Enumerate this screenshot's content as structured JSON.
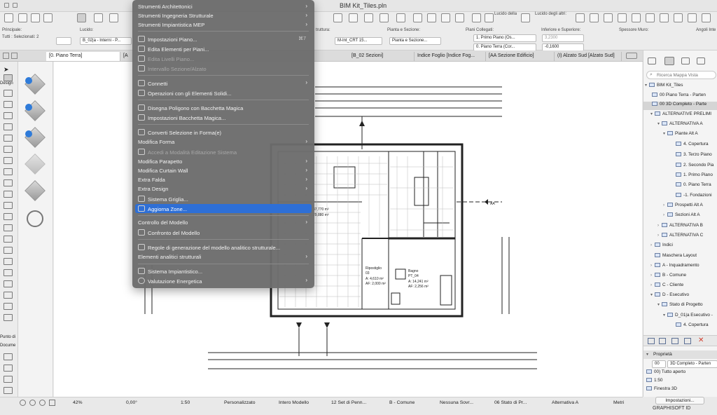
{
  "window": {
    "title": "BIM Kit_Tiles.pln"
  },
  "toolbar": {
    "principale": "Principale:",
    "selezionati": "Tutti : Selezionati: 2",
    "lucido_label": "Lucido:",
    "lucido_value": "B_02|a - Interni - P...",
    "struttura_label": "truttura:",
    "struttura_value": "M-Int_CRT 15...",
    "pianta_sezione_label": "Pianta e Sezione:",
    "pianta_sezione_value": "Pianta e Sezione...",
    "piani_collegati_label": "Piani Collegati:",
    "piano_1": "1. Primo Piano (Os...",
    "piano_0": "0. Piano Terra (Cor...",
    "inferiore_label": "Inferiore e Superiore:",
    "inferiore_1": "3,2300",
    "inferiore_2": "-0,1600",
    "spessore_label": "Spessore Muro:",
    "angoli_label": "Angoli Inte",
    "lucido_della": "Lucido della",
    "lucido_degli_altri": "Lucido degli altri:"
  },
  "tabs": [
    {
      "label": "[0. Piano Terra]"
    },
    {
      "label": "[A"
    },
    {
      "label": "[B_02 Sezioni]"
    },
    {
      "label": "Indice Foglio [Indice Fog..."
    },
    {
      "label": "[AA Sezione Edificio]"
    },
    {
      "label": "(I) Alzato Sud [Alzato Sud]"
    }
  ],
  "toolbox": {
    "design_label": "Design",
    "documento_label": "Docume",
    "punto_label": "Punto di"
  },
  "menu": {
    "items": [
      {
        "label": "Strumenti Architettonici",
        "submenu": true
      },
      {
        "label": "Strumenti Ingegneria Strutturale",
        "submenu": true
      },
      {
        "label": "Strumenti Impiantistica MEP",
        "submenu": true
      },
      {
        "label": "Impostazioni Piano...",
        "shortcut": "⌘7"
      },
      {
        "label": "Edita Elementi per Piani..."
      },
      {
        "label": "Edita Livelli Piano...",
        "disabled": true
      },
      {
        "label": "Intervallo Sezione/Alzato",
        "disabled": true
      },
      {
        "label": "Connetti",
        "submenu": true
      },
      {
        "label": "Operazioni con gli Elementi Solidi..."
      },
      {
        "label": "Disegna Poligono con Bacchetta Magica"
      },
      {
        "label": "Impostazioni Bacchetta Magica..."
      },
      {
        "label": "Converti Selezione in Forma(e)"
      },
      {
        "label": "Modifica Forma",
        "submenu": true
      },
      {
        "label": "Accedi a Modalità Editazione Sistema",
        "disabled": true
      },
      {
        "label": "Modifica Parapetto",
        "submenu": true
      },
      {
        "label": "Modifica Curtain Wall",
        "submenu": true
      },
      {
        "label": "Extra Falda",
        "submenu": true
      },
      {
        "label": "Extra Design",
        "submenu": true
      },
      {
        "label": "Sistema Griglia..."
      },
      {
        "label": "Aggiorna Zone...",
        "highlighted": true
      },
      {
        "label": "Controllo del Modello",
        "submenu": true
      },
      {
        "label": "Confronto del Modello"
      },
      {
        "label": "Regole di generazione del modello analitico strutturale..."
      },
      {
        "label": "Elementi analitici strutturali",
        "submenu": true
      },
      {
        "label": "Sistema Impiantistico..."
      },
      {
        "label": "Valutazione Energetica",
        "submenu": true
      }
    ]
  },
  "plan": {
    "room1_name": "Bagno",
    "room1_code": "PT_04",
    "room1_area": "A: 14,241 m²",
    "room1_af": "AF: 2,256 m²",
    "room2_name": "Ripostiglio",
    "room2_code": "03",
    "room2_a": "A: 4,610 m²",
    "room2_af": "AF: 2,000 m²",
    "dim1": "37,770 m²",
    "dim2": "29,880 m²",
    "section_tag": "AA"
  },
  "navigator": {
    "search_placeholder": "Ricerca Mappa Vista",
    "items": [
      {
        "label": "BIM Kit_Tiles",
        "depth": 0
      },
      {
        "label": "00 Piano Terra - Parten",
        "depth": 1
      },
      {
        "label": "00 3D Completo - Parte",
        "depth": 1,
        "selected": true
      },
      {
        "label": "ALTERNATIVE PRELIMI",
        "depth": 1
      },
      {
        "label": "ALTERNATIVA A",
        "depth": 2
      },
      {
        "label": "Piante Alt A",
        "depth": 3
      },
      {
        "label": "4. Copertura",
        "depth": 4
      },
      {
        "label": "3. Terzo Piano",
        "depth": 4
      },
      {
        "label": "2. Secondo Pia",
        "depth": 4
      },
      {
        "label": "1. Primo Piano",
        "depth": 4
      },
      {
        "label": "0. Piano Terra",
        "depth": 4
      },
      {
        "label": "-1. Fondazioni",
        "depth": 4
      },
      {
        "label": "Prospetti Alt A",
        "depth": 3
      },
      {
        "label": "Sezioni Alt A",
        "depth": 3
      },
      {
        "label": "ALTERNATIVA B",
        "depth": 2
      },
      {
        "label": "ALTERNATIVA C",
        "depth": 2
      },
      {
        "label": "Indici",
        "depth": 1
      },
      {
        "label": "Maschera Layout",
        "depth": 1
      },
      {
        "label": "A - Inquadramento",
        "depth": 1
      },
      {
        "label": "B - Comune",
        "depth": 1
      },
      {
        "label": "C - Cliente",
        "depth": 1
      },
      {
        "label": "D - Esecutivo",
        "depth": 1
      },
      {
        "label": "Stato di Progetto",
        "depth": 2
      },
      {
        "label": "D_01|a Esecutivo -",
        "depth": 3
      },
      {
        "label": "4. Copertura",
        "depth": 4
      }
    ],
    "properties_label": "Proprietà",
    "prop_id": "00",
    "prop_name": "3D Completo - Parten",
    "prop_layers": "00) Tutto aperto",
    "prop_scale": "1:50",
    "prop_window": "Finestra 3D",
    "settings_button": "Impostazioni..."
  },
  "statusbar": {
    "zoom": "42%",
    "angle": "0,00°",
    "scale": "1:50",
    "custom": "Personalizzato",
    "model": "Intero Modello",
    "pens": "12 Set di Penn...",
    "layer": "B - Comune",
    "override": "Nessuna Sovr...",
    "status": "06 Stato di Pr...",
    "alternative": "Alternativa A",
    "units": "Metri",
    "brand": "GRAPHISOFT ID"
  },
  "colors": {
    "highlight": "#2e6fd6",
    "menu_bg": "#6c6c6c"
  }
}
